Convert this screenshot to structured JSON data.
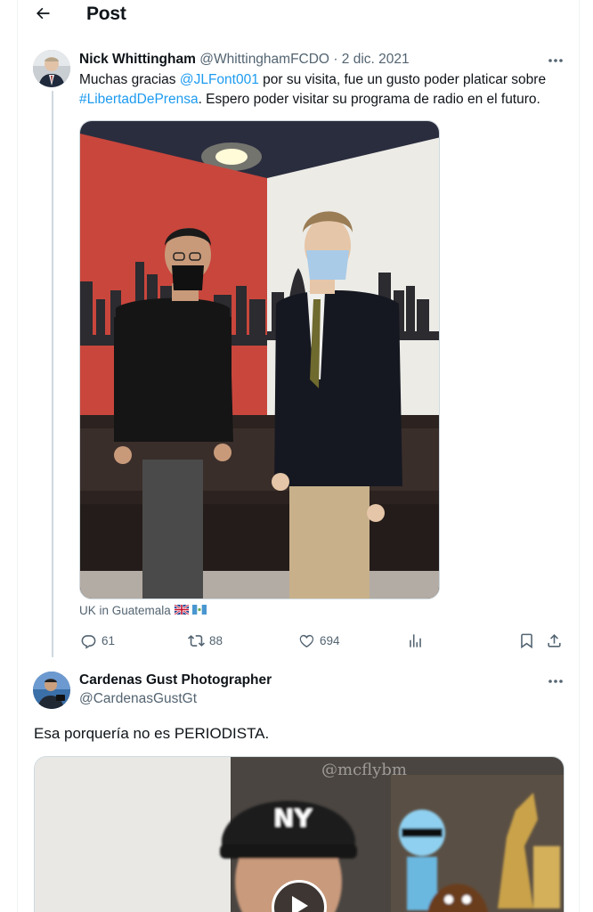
{
  "header": {
    "title": "Post",
    "back_icon": "arrow-left-icon"
  },
  "tweet1": {
    "author_name": "Nick Whittingham",
    "handle": "@WhittinghamFCDO",
    "separator": "·",
    "date": "2 dic. 2021",
    "text_before_mention": "Muchas gracias ",
    "mention": "@JLFont001",
    "text_after_mention": " por su visita, fue un gusto poder platicar sobre",
    "hashtag": "#LibertadDePrensa",
    "text_after_hashtag": ". Espero poder visitar su programa de radio en el futuro.",
    "source": "UK in Guatemala",
    "source_flags": [
      "uk-flag",
      "guatemala-flag"
    ],
    "stats": {
      "replies": "61",
      "reposts": "88",
      "likes": "694"
    },
    "icons": [
      "reply-icon",
      "repost-icon",
      "like-icon",
      "views-icon",
      "bookmark-icon",
      "share-icon"
    ]
  },
  "tweet2": {
    "author_name": "Cardenas Gust Photographer",
    "handle": "@CardenasGustGt",
    "text": "Esa porquería no es PERIODISTA.",
    "video_watermark": "@mcflybm",
    "video_icon": "play-icon"
  },
  "colors": {
    "link": "#1d9bf0",
    "muted": "#536471",
    "text": "#0f1419",
    "border": "#cfd9de"
  }
}
